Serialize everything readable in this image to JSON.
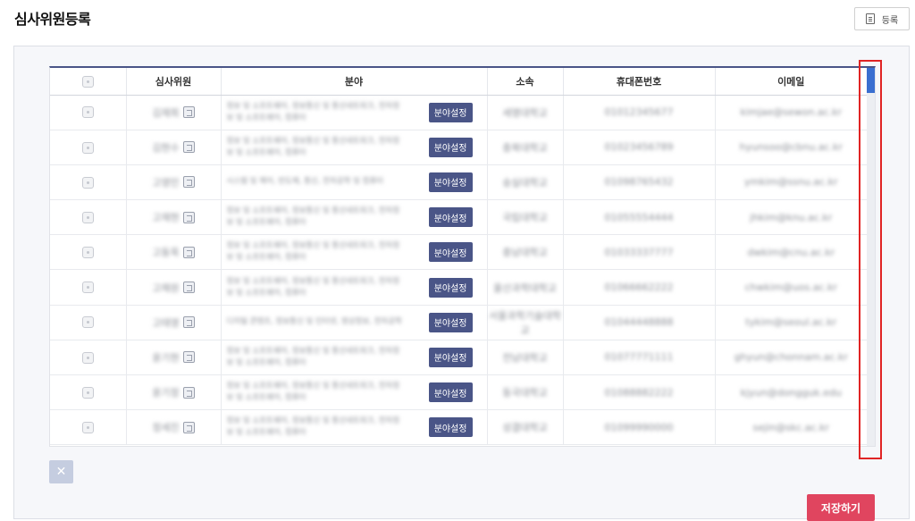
{
  "header": {
    "title": "심사위원등록",
    "register_label": "등록"
  },
  "table": {
    "columns": [
      "",
      "심사위원",
      "분야",
      "소속",
      "휴대폰번호",
      "이메일"
    ],
    "field_button_label": "분야설정",
    "rows": [
      {
        "name": "김재희",
        "field": "정보 및 소프트웨어, 정보통신 및 통신네트워크, 전자정보 및 소프트웨어, 컴퓨터",
        "org": "세명대학교",
        "phone": "01012345677",
        "email": "kimjae@sewon.ac.kr"
      },
      {
        "name": "김현수",
        "field": "정보 및 소프트웨어, 정보통신 및 통신네트워크, 전자정보 및 소프트웨어, 컴퓨터",
        "org": "충북대학교",
        "phone": "01023456789",
        "email": "hyunsoo@cbnu.ac.kr"
      },
      {
        "name": "고영민",
        "field": "시스템 및 제어, 반도체, 통신, 전자공학 및 컴퓨터 ",
        "org": "숭실대학교",
        "phone": "01098765432",
        "email": "ymkim@ssnu.ac.kr"
      },
      {
        "name": "고재현",
        "field": "정보 및 소프트웨어, 정보통신 및 통신네트워크, 전자정보 및 소프트웨어, 컴퓨터",
        "org": "국립대학교",
        "phone": "01055554444",
        "email": "jhkim@knu.ac.kr"
      },
      {
        "name": "고동욱",
        "field": "정보 및 소프트웨어, 정보통신 및 통신네트워크, 전자정보 및 소프트웨어, 컴퓨터",
        "org": "충남대학교",
        "phone": "01033337777",
        "email": "dwkim@cnu.ac.kr"
      },
      {
        "name": "고채원",
        "field": "정보 및 소프트웨어, 정보통신 및 통신네트워크, 전자정보 및 소프트웨어, 컴퓨터",
        "org": "울산과학대학교",
        "phone": "01066662222",
        "email": "chwkim@uos.ac.kr"
      },
      {
        "name": "고태영",
        "field": "디지털 콘텐츠, 정보통신 및 인터넷, 영상정보, 전자공학",
        "org": "서울과학기술대학교",
        "phone": "01044448888",
        "email": "tykim@seoul.ac.kr"
      },
      {
        "name": "윤기현",
        "field": "정보 및 소프트웨어, 정보통신 및 통신네트워크, 전자정보 및 소프트웨어, 컴퓨터",
        "org": "전남대학교",
        "phone": "01077771111",
        "email": "ghyun@chonnam.ac.kr"
      },
      {
        "name": "윤기정",
        "field": "정보 및 소프트웨어, 정보통신 및 통신네트워크, 전자정보 및 소프트웨어, 컴퓨터",
        "org": "동국대학교",
        "phone": "01088882222",
        "email": "kjyun@dongguk.edu"
      },
      {
        "name": "정세진",
        "field": "정보 및 소프트웨어, 정보통신 및 통신네트워크, 전자정보 및 소프트웨어, 컴퓨터",
        "org": "성결대학교",
        "phone": "01099990000",
        "email": "sejin@skc.ac.kr"
      }
    ]
  },
  "footer": {
    "delete_icon": "close-icon",
    "save_label": "저장하기"
  },
  "colors": {
    "accent": "#4a5587",
    "save": "#e0455f",
    "scroll_thumb": "#3a6fd0",
    "highlight": "#e02424"
  }
}
